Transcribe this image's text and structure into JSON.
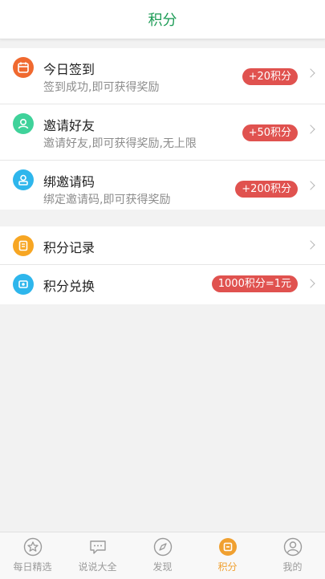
{
  "header": {
    "title": "积分"
  },
  "tasks": [
    {
      "title": "今日签到",
      "desc": "签到成功,即可获得奖励",
      "badge": "+20积分",
      "icon": "calendar-icon",
      "color": "#f0692f"
    },
    {
      "title": "邀请好友",
      "desc": "邀请好友,即可获得奖励,无上限",
      "badge": "+50积分",
      "icon": "user-invite-icon",
      "color": "#3fd29a"
    },
    {
      "title": "绑邀请码",
      "desc": "绑定邀请码,即可获得奖励",
      "badge": "+200积分",
      "icon": "bind-user-icon",
      "color": "#2eb6ec"
    }
  ],
  "menu": [
    {
      "title": "积分记录",
      "badge": "",
      "icon": "record-icon",
      "color": "#f7a623"
    },
    {
      "title": "积分兑换",
      "badge": "1000积分=1元",
      "icon": "exchange-icon",
      "color": "#2eb6ec"
    }
  ],
  "tabs": [
    {
      "label": "每日精选",
      "icon": "star-icon"
    },
    {
      "label": "说说大全",
      "icon": "chat-bubble-icon"
    },
    {
      "label": "发现",
      "icon": "compass-icon"
    },
    {
      "label": "积分",
      "icon": "points-icon",
      "active": true
    },
    {
      "label": "我的",
      "icon": "profile-icon"
    }
  ],
  "colors": {
    "accent": "#1e9c57",
    "badge": "#e0524f",
    "tab_active": "#f0a030",
    "tab_inactive": "#9a9a9a"
  }
}
